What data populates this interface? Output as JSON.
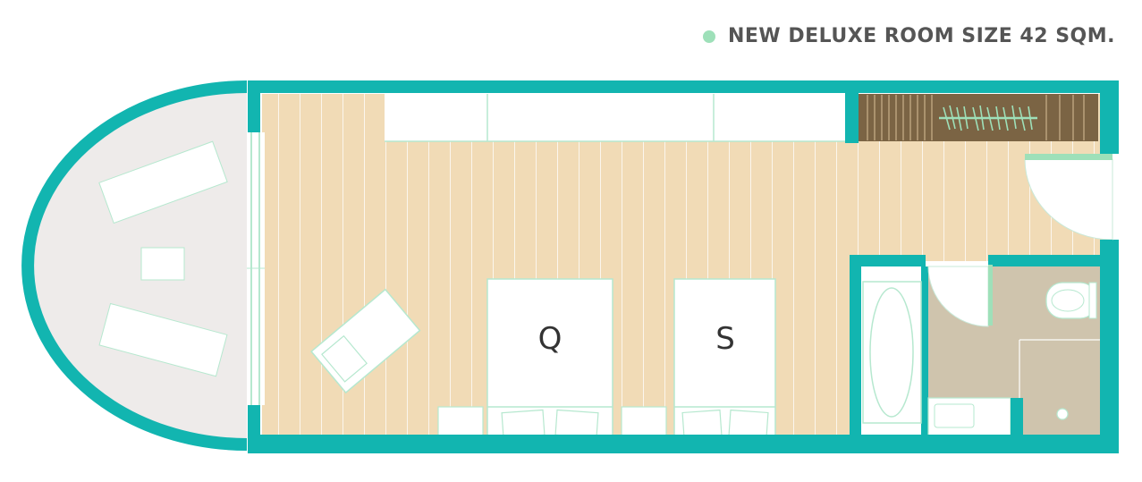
{
  "legend": {
    "label": "NEW DELUXE ROOM SIZE 42 SQM.",
    "dot_color": "#9ee0b9"
  },
  "beds": [
    {
      "letter": "Q"
    },
    {
      "letter": "S"
    }
  ],
  "colors": {
    "wall": "#12b5b0",
    "floor": "#f1dbb6",
    "balcony": "#eeebea",
    "closet": "#7b6444",
    "bath_floor": "#cfc4ad",
    "accent_line": "#9ee0b9"
  }
}
